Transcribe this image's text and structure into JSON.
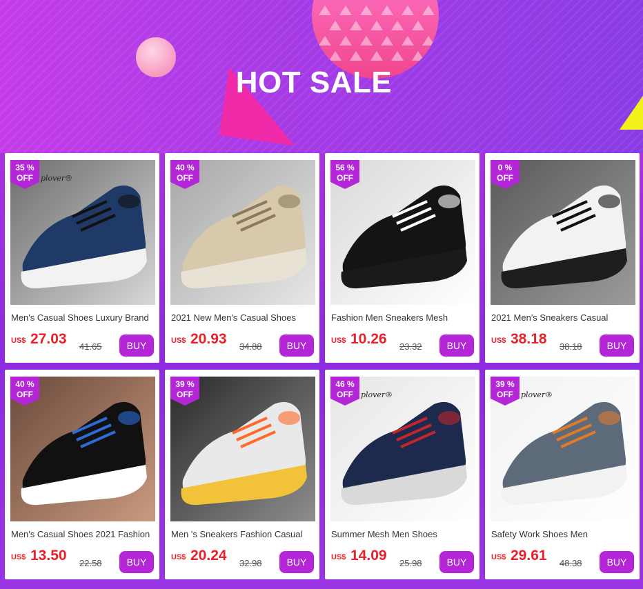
{
  "banner": {
    "title": "HOT SALE"
  },
  "colors": {
    "accent": "#b526d8",
    "price": "#e8202a",
    "badge": "#b526d8"
  },
  "currency": "US$",
  "buy_label": "BUY",
  "off_label": "OFF",
  "products": [
    {
      "badge": "35 %",
      "title": "Men's Casual Shoes Luxury Brand",
      "price": "27.03",
      "original": "41.65",
      "brand_mark": "plover®"
    },
    {
      "badge": "40 %",
      "title": "2021 New Men's Casual Shoes",
      "price": "20.93",
      "original": "34.88"
    },
    {
      "badge": "56 %",
      "title": "Fashion Men Sneakers Mesh",
      "price": "10.26",
      "original": "23.32"
    },
    {
      "badge": "0 %",
      "title": "2021 Men's Sneakers Casual",
      "price": "38.18",
      "original": "38.18"
    },
    {
      "badge": "40 %",
      "title": "Men's Casual Shoes 2021 Fashion",
      "price": "13.50",
      "original": "22.58"
    },
    {
      "badge": "39 %",
      "title": "Men  's Sneakers Fashion Casual",
      "price": "20.24",
      "original": "32.98"
    },
    {
      "badge": "46 %",
      "title": "Summer Mesh Men Shoes",
      "price": "14.09",
      "original": "25.98",
      "brand_mark": "plover®"
    },
    {
      "badge": "39 %",
      "title": "Safety Work Shoes Men",
      "price": "29.61",
      "original": "48.38",
      "brand_mark": "plover®"
    }
  ]
}
